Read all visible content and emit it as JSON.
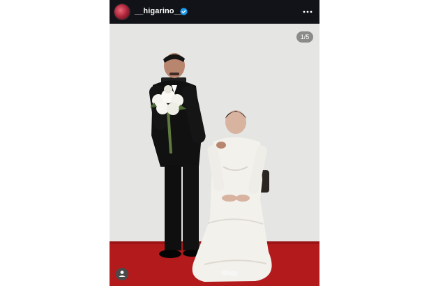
{
  "post": {
    "username": "__higarino__",
    "verified": true,
    "page_counter": "1/5",
    "icons": {
      "verified": "verified-check-icon",
      "more": "more-dots-icon",
      "tag": "user-tag-icon"
    },
    "colors": {
      "header_bg": "#111318",
      "backdrop": "#e5e6e3",
      "carpet": "#b21a1b",
      "verified_blue": "#1d9bf0"
    }
  }
}
